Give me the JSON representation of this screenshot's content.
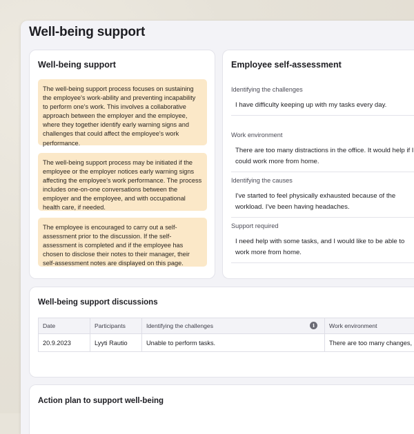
{
  "page": {
    "title": "Well-being support"
  },
  "support_card": {
    "title": "Well-being support",
    "notes": [
      "The well-being support process focuses on sustaining the employee's work-ability and preventing incapability to perform one's work. This involves a collaborative approach between the employer and the employee, where they together identify early warning signs and challenges that could affect the employee's work performance.",
      "The well-being support process may be initiated if the employee or the employer notices early warning signs affecting the employee's work performance. The process includes one-on-one conversations between the employer and the employee, and with occupational health care, if needed.",
      "The employee is encouraged to carry out a self-assessment prior to the discussion. If the self-assessment is completed and if the employee has chosen to disclose their notes to their manager, their self-assessment notes are displayed on this page."
    ]
  },
  "assessment_card": {
    "title": "Employee self-assessment",
    "items": [
      {
        "label": "Identifying the challenges",
        "text": "I have difficulty keeping up with my tasks every day."
      },
      {
        "label": "Work environment",
        "text": "There are too many distractions in the office. It would help if I could work more from home."
      },
      {
        "label": "Identifying the causes",
        "text": "I've started to feel physically exhausted because of the workload. I've been having headaches."
      },
      {
        "label": "Support required",
        "text": "I need help with some tasks, and I would like to be able to work more from home."
      }
    ]
  },
  "discussions_card": {
    "title": "Well-being support discussions",
    "columns": [
      "Date",
      "Participants",
      "Identifying the challenges",
      "Work environment"
    ],
    "info_icon": "info-icon",
    "rows": [
      {
        "date": "20.9.2023",
        "participants": "Lyyti Rautio",
        "challenges": "Unable to perform tasks.",
        "environment": "There are too many changes,"
      }
    ]
  },
  "action_card": {
    "title": "Action plan to support well-being"
  }
}
